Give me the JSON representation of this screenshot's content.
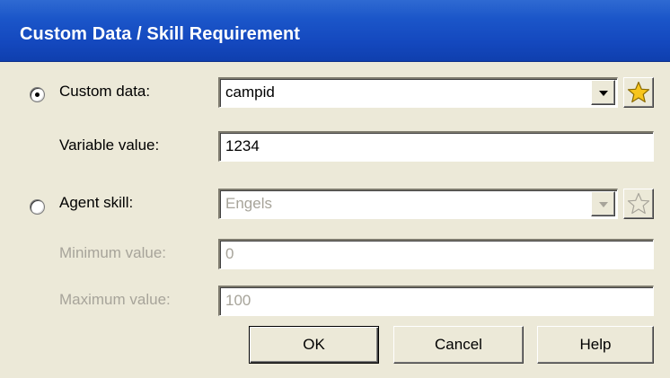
{
  "window": {
    "title": "Custom Data / Skill Requirement"
  },
  "custom_data": {
    "radio_label": "Custom data:",
    "radio_selected": true,
    "value": "campid",
    "variable_label": "Variable value:",
    "variable_value": "1234"
  },
  "agent_skill": {
    "radio_label": "Agent skill:",
    "radio_selected": false,
    "value": "Engels",
    "minimum_label": "Minimum value:",
    "minimum_value": "0",
    "maximum_label": "Maximum value:",
    "maximum_value": "100"
  },
  "buttons": {
    "ok": "OK",
    "cancel": "Cancel",
    "help": "Help"
  },
  "icons": {
    "star_enabled": "star-icon",
    "star_disabled": "star-icon",
    "dropdown": "chevron-down-icon"
  },
  "colors": {
    "titlebar": "#1448be",
    "dialog_bg": "#ece9d8",
    "disabled_text": "#a7a49a",
    "star_fill": "#f7c51c"
  }
}
